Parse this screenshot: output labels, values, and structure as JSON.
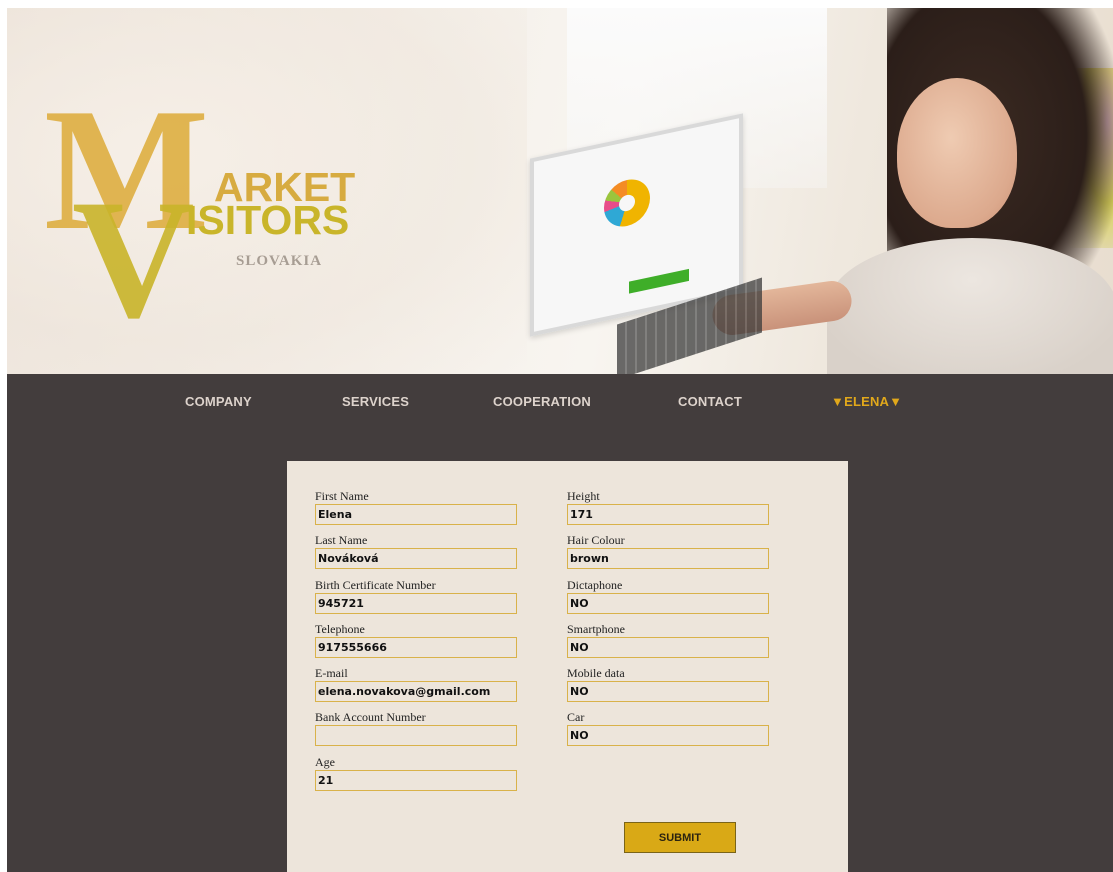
{
  "brand": {
    "line1": "ARKET",
    "line2": "ISITORS",
    "big_m": "M",
    "big_v": "V",
    "country": "SLOVAKIA",
    "gold": "#d9b04a",
    "olive": "#c9b52a"
  },
  "nav": {
    "items": [
      {
        "label": "COMPANY"
      },
      {
        "label": "SERVICES"
      },
      {
        "label": "COOPERATION"
      },
      {
        "label": "CONTACT"
      },
      {
        "label": "▼ELENA▼"
      }
    ],
    "active_color": "#e1a81b"
  },
  "form": {
    "left": [
      {
        "label": "First Name",
        "value": "Elena"
      },
      {
        "label": "Last Name",
        "value": "Nováková"
      },
      {
        "label": "Birth Certificate Number",
        "value": "945721"
      },
      {
        "label": "Telephone",
        "value": "917555666"
      },
      {
        "label": "E-mail",
        "value": "elena.novakova@gmail.com"
      },
      {
        "label": "Bank Account Number",
        "value": ""
      },
      {
        "label": "Age",
        "value": "21"
      }
    ],
    "right": [
      {
        "label": "Height",
        "value": "171"
      },
      {
        "label": "Hair Colour",
        "value": "brown"
      },
      {
        "label": "Dictaphone",
        "value": "NO"
      },
      {
        "label": "Smartphone",
        "value": "NO"
      },
      {
        "label": "Mobile data",
        "value": "NO"
      },
      {
        "label": "Car",
        "value": "NO"
      }
    ],
    "submit_label": "SUBMIT"
  }
}
